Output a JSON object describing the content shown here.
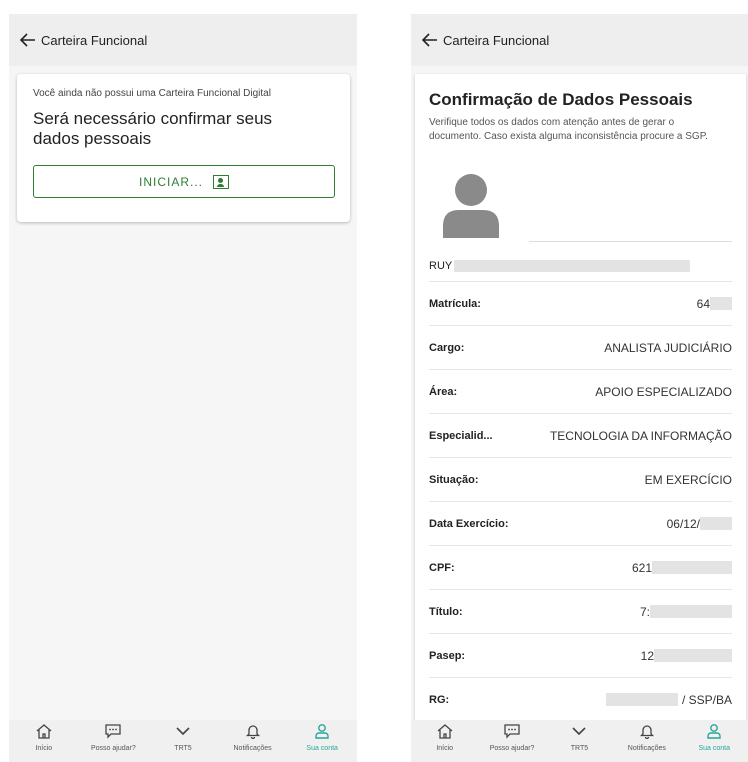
{
  "screens": {
    "left": {
      "appbar": {
        "title": "Carteira Funcional"
      },
      "card": {
        "notice": "Você ainda não possui uma Carteira Funcional Digital",
        "headline": "Será necessário confirmar seus dados pessoais",
        "start_label": "INICIAR..."
      }
    },
    "right": {
      "appbar": {
        "title": "Carteira Funcional"
      },
      "card": {
        "title": "Confirmação de Dados Pessoais",
        "subtitle": "Verifique todos os dados com atenção antes de gerar o documento. Caso exista alguma inconsistência procure a SGP.",
        "name_prefix": "RUY",
        "rows": [
          {
            "label": "Matrícula:",
            "value": "64"
          },
          {
            "label": "Cargo:",
            "value": "ANALISTA JUDICIÁRIO"
          },
          {
            "label": "Área:",
            "value": "APOIO ESPECIALIZADO"
          },
          {
            "label": "Especialid...",
            "value": "TECNOLOGIA DA INFORMAÇÃO"
          },
          {
            "label": "Situação:",
            "value": "EM EXERCÍCIO"
          },
          {
            "label": "Data Exercício:",
            "value": "06/12/"
          },
          {
            "label": "CPF:",
            "value": "621"
          },
          {
            "label": "Título:",
            "value": "7:"
          },
          {
            "label": "Pasep:",
            "value": "12"
          },
          {
            "label": "RG:",
            "value_suffix": "/ SSP/BA"
          }
        ]
      }
    }
  },
  "bottom_nav": {
    "items": [
      {
        "label": "Início",
        "icon": "home-icon"
      },
      {
        "label": "Posso ajudar?",
        "icon": "chat-icon"
      },
      {
        "label": "TRT5",
        "icon": "chevron-down-icon"
      },
      {
        "label": "Notificações",
        "icon": "bell-icon"
      },
      {
        "label": "Sua conta",
        "icon": "person-icon"
      }
    ],
    "active_color": "#26a69a"
  },
  "colors": {
    "accent": "#2e7d32",
    "appbar": "#eeeeef"
  }
}
